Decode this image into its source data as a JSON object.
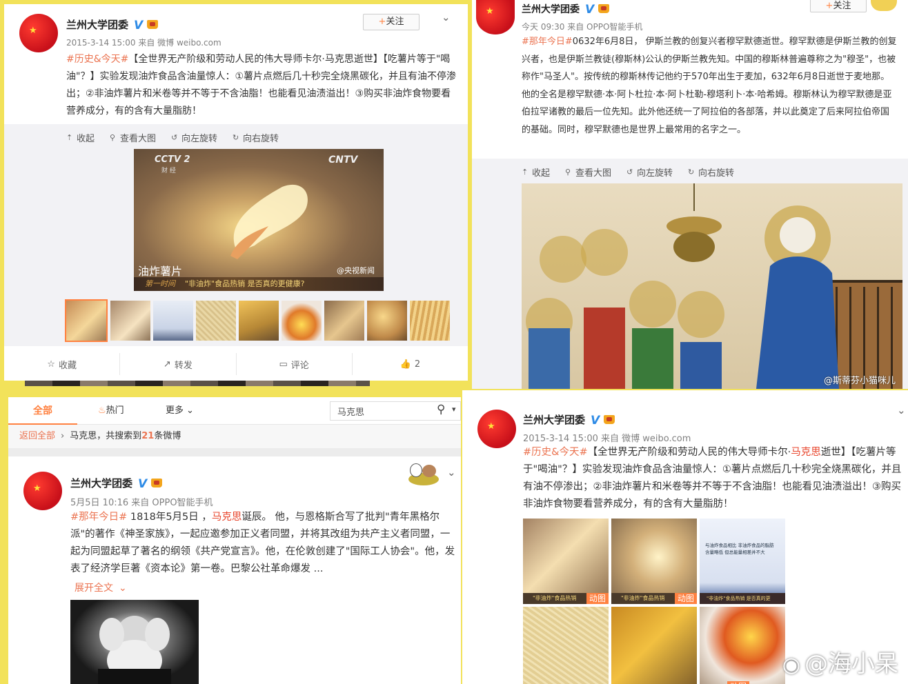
{
  "colors": {
    "background": "#f2e25a",
    "topic": "#eb7350",
    "highlight": "#e8452c",
    "accent": "#ff8140",
    "verified": "#2e8be6"
  },
  "p1": {
    "user": "兰州大学团委",
    "meta": "2015-3-14 15:00 来自 微博 weibo.com",
    "follow": "关注",
    "topic": "#历史&今天#",
    "text": "【全世界无产阶级和劳动人民的伟大导师卡尔·马克思逝世】【吃薯片等于\"喝油\"？】实验发现油炸食品含油量惊人：①薯片点燃后几十秒完全烧黑碳化，并且有油不停渗出；②非油炸薯片和米卷等并不等于不含油脂！也能看见油渍溢出！③购买非油炸食物要看营养成分，有的含有大量脂肪！",
    "toolbar": [
      "收起",
      "查看大图",
      "向左旋转",
      "向右旋转"
    ],
    "image": {
      "logo": "CCTV 2",
      "logo_sub": "财 经",
      "cntv": "CNTV",
      "caption": "油炸薯片",
      "source": "@央视新闻",
      "ticker_left": "第一时间",
      "ticker": "\"非油炸\"食品热销 是否真的更健康?"
    },
    "actions": {
      "fav": "收藏",
      "repost": "转发",
      "comment": "评论",
      "like": "2"
    }
  },
  "p2": {
    "user": "兰州大学团委",
    "follow": "关注",
    "meta": "今天 09:30 来自 OPPO智能手机",
    "topic": "#那年今日#",
    "text": "0632年6月8日， 伊斯兰教的创复兴者穆罕默德逝世。穆罕默德是伊斯兰教的创复兴者，也是伊斯兰教徒(穆斯林)公认的伊斯兰教先知。中国的穆斯林普遍尊称之为\"穆圣\"，也被称作\"马圣人\"。按传统的穆斯林传记他约于570年出生于麦加，632年6月8日逝世于麦地那。他的全名是穆罕默德·本·阿卜杜拉·本·阿卜杜勒-穆塔利卜·本·哈希姆。穆斯林认为穆罕默德是亚伯拉罕诸教的最后一位先知。此外他还统一了阿拉伯的各部落，并以此奠定了后来阿拉伯帝国的基础。同时，穆罕默德也是世界上最常用的名字之一。",
    "toolbar": [
      "收起",
      "查看大图",
      "向左旋转",
      "向右旋转"
    ],
    "watermark": "@斯蒂芬小猫咪儿"
  },
  "p3": {
    "tabs": [
      "全部",
      "热门",
      "更多"
    ],
    "search_value": "马克思",
    "crumb_back": "返回全部",
    "crumb_kw": "马克思，共搜索到",
    "crumb_count": "21",
    "crumb_tail": "条微博",
    "user": "兰州大学团委",
    "meta": "5月5日 10:16 来自 OPPO智能手机",
    "topic": "#那年今日#",
    "text_a": " 1818年5月5日 ，",
    "text_hl": "马克思",
    "text_b": "诞辰。 他，与恩格斯合写了批判\"青年黑格尔派\"的著作《神圣家族》，一起应邀参加正义者同盟，并将其改组为共产主义者同盟，一起为同盟起草了著名的纲领《共产党宣言》。他，在伦敦创建了\"国际工人协会\"。他，发表了经济学巨著《资本论》第一卷。巴黎公社革命爆发 ...",
    "expand": "展开全文"
  },
  "p4": {
    "user": "兰州大学团委",
    "meta": "2015-3-14 15:00 来自 微博 weibo.com",
    "topic": "#历史&今天#",
    "text_a": "【全世界无产阶级和劳动人民的伟大导师卡尔·",
    "text_hl": "马克思",
    "text_b": "逝世】【吃薯片等于\"喝油\"？】实验发现油炸食品含油量惊人：①薯片点燃后几十秒完全烧黑碳化，并且有油不停渗出；②非油炸薯片和米卷等并不等于不含油脂！也能看见油渍溢出！③购买非油炸食物要看营养成分，有的含有大量脂肪！",
    "gif_label": "动图",
    "thumb_caption_a": "\"非油炸\"食品热销",
    "thumb_caption_c": "\"非油炸\"食品热销 是否真的更",
    "doc_text": "与油炸食品相比 非油炸食品的脂肪含量略低 但总能量相差并不大",
    "watermark": "@海小呆"
  }
}
